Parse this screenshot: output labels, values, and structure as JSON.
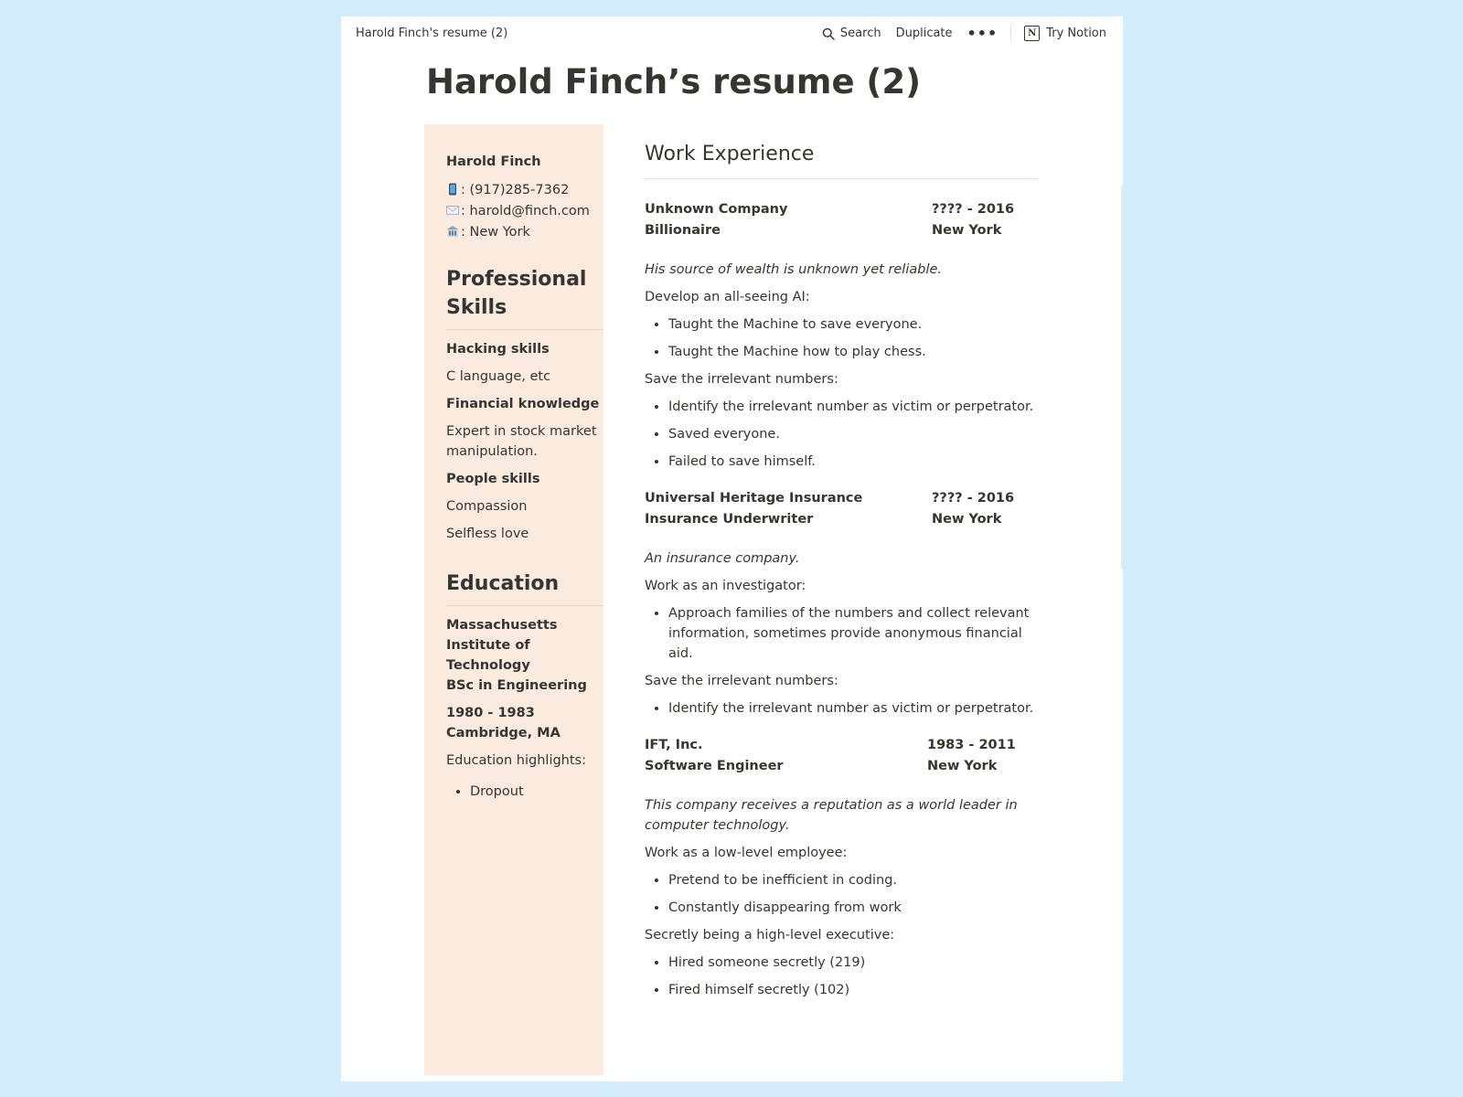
{
  "topbar": {
    "breadcrumb": "Harold Finch's resume (2)",
    "search": "Search",
    "duplicate": "Duplicate",
    "more": "•••",
    "try_notion": "Try Notion",
    "notion_letter": "N"
  },
  "page": {
    "title": "Harold Finch’s resume (2)"
  },
  "sidebar": {
    "name": "Harold Finch",
    "phone": ": (917)285-7362",
    "email": ": harold@finch.com",
    "location": ": New York",
    "skills_heading": "Professional Skills",
    "skills": [
      {
        "title": "Hacking skills",
        "detail": "C language, etc"
      },
      {
        "title": "Financial knowledge",
        "detail": "Expert in stock market manipulation."
      },
      {
        "title": "People skills",
        "detail": "Compassion",
        "detail2": "Selfless love"
      }
    ],
    "education_heading": "Education",
    "school": "Massachusetts Institute of Technology",
    "degree": "BSc in Engineering",
    "years": "1980 - 1983",
    "city": "Cambridge, MA",
    "highlights_label": "Education highlights:",
    "highlights": [
      "Dropout"
    ]
  },
  "main": {
    "heading": "Work Experience",
    "jobs": [
      {
        "company": "Unknown Company",
        "dates": "???? - 2016",
        "role": "Billionaire",
        "location": "New York",
        "intro": "His source of wealth is unknown yet reliable.",
        "sections": [
          {
            "label": "Develop an all-seeing AI:",
            "items": [
              "Taught the Machine to save everyone.",
              "Taught the Machine how to play chess."
            ]
          },
          {
            "label": "Save the irrelevant numbers:",
            "items": [
              "Identify the irrelevant number as victim or perpetrator.",
              "Saved everyone.",
              "Failed to save himself."
            ]
          }
        ]
      },
      {
        "company": "Universal Heritage Insurance",
        "dates": "???? - 2016",
        "role": "Insurance Underwriter",
        "location": "New York",
        "intro": "An insurance company.",
        "sections": [
          {
            "label": "Work as an investigator:",
            "items": [
              "Approach families of the numbers and collect relevant information, sometimes provide anonymous financial aid."
            ]
          },
          {
            "label": "Save the irrelevant numbers:",
            "items": [
              "Identify the irrelevant number as victim or perpetrator."
            ]
          }
        ]
      },
      {
        "company": "IFT, Inc.",
        "dates": "1983 - 2011",
        "role": "Software Engineer",
        "location": "New York",
        "intro": "This company receives a reputation as a world leader in computer technology.",
        "sections": [
          {
            "label": "Work as a low-level employee:",
            "items": [
              "Pretend to be inefficient in coding.",
              "Constantly disappearing from work"
            ]
          },
          {
            "label": "Secretly being a high-level executive:",
            "items": [
              "Hired someone secretly (219)",
              "Fired himself secretly (102)"
            ]
          }
        ]
      }
    ]
  }
}
